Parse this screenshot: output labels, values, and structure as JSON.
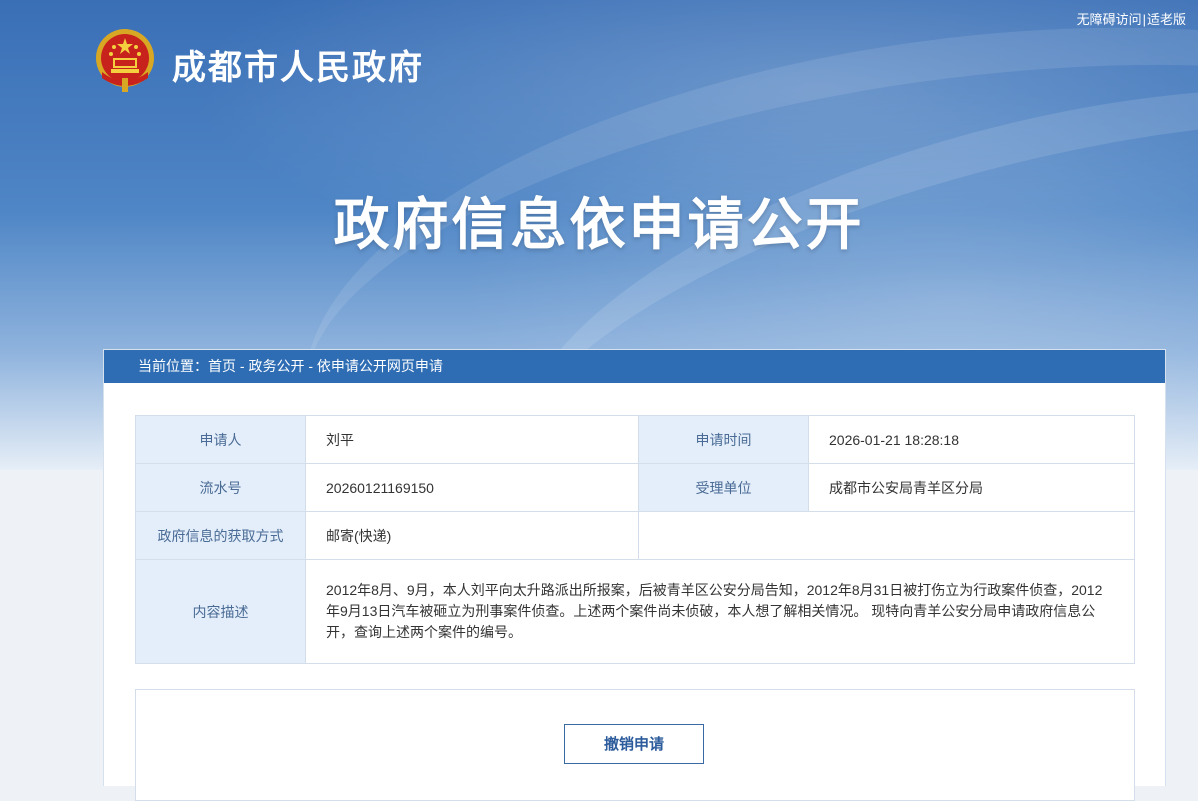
{
  "header": {
    "accessibility_link": "无障碍访问",
    "separator": "|",
    "elderly_link": "适老版",
    "site_title": "成都市人民政府",
    "banner_title": "政府信息依申请公开"
  },
  "breadcrumb": {
    "prefix": "当前位置：",
    "items": [
      "首页",
      "政务公开",
      "依申请公开网页申请"
    ],
    "sep": " - "
  },
  "application": {
    "applicant_label": "申请人",
    "applicant_value": "刘平",
    "time_label": "申请时间",
    "time_value": "2026-01-21 18:28:18",
    "serial_label": "流水号",
    "serial_value": "20260121169150",
    "unit_label": "受理单位",
    "unit_value": "成都市公安局青羊区分局",
    "method_label": "政府信息的获取方式",
    "method_value": "邮寄(快递)",
    "desc_label": "内容描述",
    "desc_value": "2012年8月、9月，本人刘平向太升路派出所报案，后被青羊区公安分局告知，2012年8月31日被打伤立为行政案件侦查，2012年9月13日汽车被砸立为刑事案件侦查。上述两个案件尚未侦破，本人想了解相关情况。 现特向青羊公安分局申请政府信息公开，查询上述两个案件的编号。"
  },
  "actions": {
    "revoke_label": "撤销申请"
  },
  "colors": {
    "banner_blue": "#3a6fb6",
    "crumb_bar": "#2e6db4",
    "label_bg": "#e3eefa"
  }
}
